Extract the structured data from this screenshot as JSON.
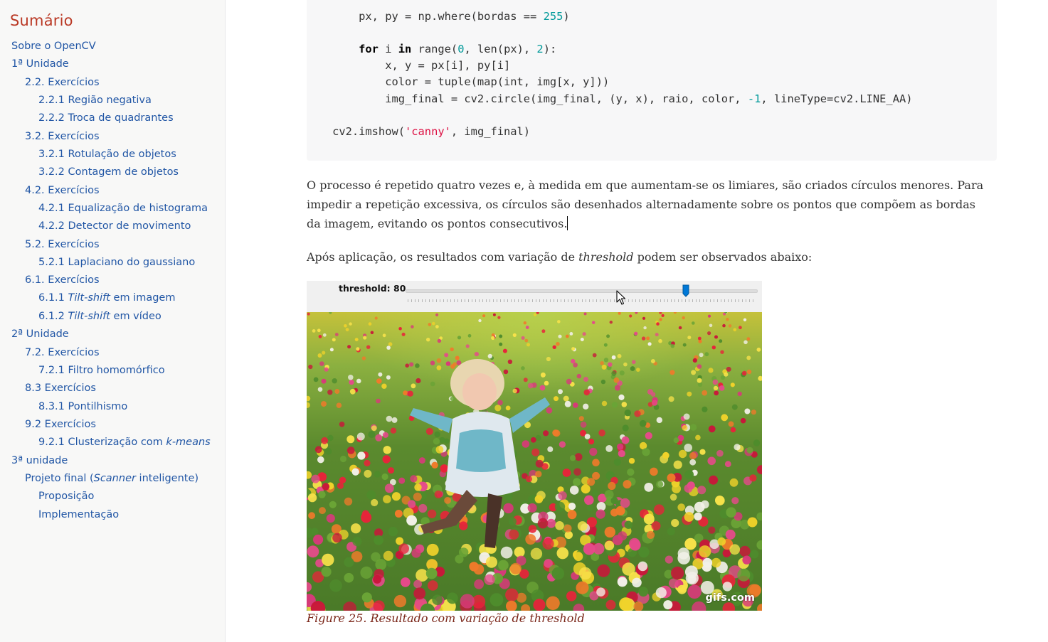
{
  "toc": {
    "title": "Sumário",
    "items": [
      {
        "level": 1,
        "text": "Sobre o OpenCV"
      },
      {
        "level": 1,
        "text": "1ª Unidade"
      },
      {
        "level": 2,
        "text": "2.2. Exercícios"
      },
      {
        "level": 3,
        "text": "2.2.1 Região negativa"
      },
      {
        "level": 3,
        "text": "2.2.2 Troca de quadrantes"
      },
      {
        "level": 2,
        "text": "3.2. Exercícios"
      },
      {
        "level": 3,
        "text": "3.2.1 Rotulação de objetos"
      },
      {
        "level": 3,
        "text": "3.2.2 Contagem de objetos"
      },
      {
        "level": 2,
        "text": "4.2. Exercícios"
      },
      {
        "level": 3,
        "text": "4.2.1 Equalização de histograma"
      },
      {
        "level": 3,
        "text": "4.2.2 Detector de movimento"
      },
      {
        "level": 2,
        "text": "5.2. Exercícios"
      },
      {
        "level": 3,
        "text": "5.2.1 Laplaciano do gaussiano"
      },
      {
        "level": 2,
        "text": "6.1. Exercícios"
      },
      {
        "level": 3,
        "text": "6.1.1 ",
        "italic": "Tilt-shift",
        "after": " em imagem"
      },
      {
        "level": 3,
        "text": "6.1.2 ",
        "italic": "Tilt-shift",
        "after": " em vídeo"
      },
      {
        "level": 1,
        "text": "2ª Unidade"
      },
      {
        "level": 2,
        "text": "7.2. Exercícios"
      },
      {
        "level": 3,
        "text": "7.2.1 Filtro homomórfico"
      },
      {
        "level": 2,
        "text": "8.3 Exercícios"
      },
      {
        "level": 3,
        "text": "8.3.1 Pontilhismo"
      },
      {
        "level": 2,
        "text": "9.2 Exercícios"
      },
      {
        "level": 3,
        "text": "9.2.1 Clusterização com ",
        "italic": "k-means",
        "after": ""
      },
      {
        "level": 1,
        "text": "3ª unidade"
      },
      {
        "level": 2,
        "text": "Projeto final (",
        "italic": "Scanner",
        "after": " inteligente)"
      },
      {
        "level": 3,
        "text": "Proposição"
      },
      {
        "level": 3,
        "text": "Implementação"
      }
    ]
  },
  "code": {
    "lines": [
      "",
      "        px, py = np.where(bordas == 255)",
      "",
      "        for i in range(0, len(px), 2):",
      "            x, y = px[i], py[i]",
      "            color = tuple(map(int, img[x, y]))",
      "            img_final = cv2.circle(img_final, (y, x), raio, color, -1, lineType=cv2.LINE_AA)",
      "",
      "    cv2.imshow('canny', img_final)"
    ]
  },
  "paragraph1": "O processo é repetido quatro vezes e, à medida em que aumentam-se os limiares, são criados círculos menores. Para impedir a repetição excessiva, os círculos são desenhados alternadamente sobre os pontos que compõem as bordas da imagem, evitando os pontos consecutivos.",
  "paragraph2": {
    "before": "Após aplicação, os resultados com variação de ",
    "em": "threshold",
    "after": " podem ser observados abaixo:"
  },
  "figure": {
    "trackbar_label": "threshold: 80",
    "slider_value_fraction": 0.8,
    "watermark": "gifs.com",
    "caption": "Figure 25. Resultado com variação de threshold"
  },
  "colors": {
    "toc_title": "#ba3925",
    "link": "#2156a5",
    "caption": "#7a2518",
    "slider_thumb": "#0078d7"
  }
}
